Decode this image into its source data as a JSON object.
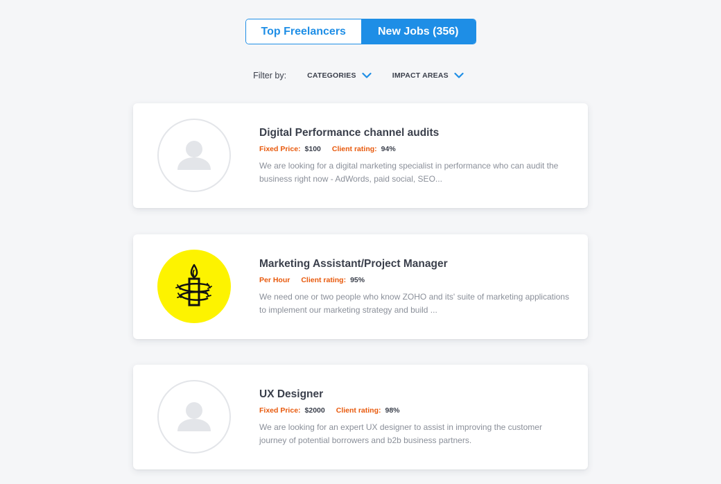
{
  "tabs": [
    {
      "label": "Top Freelancers",
      "active": false
    },
    {
      "label": "New Jobs (356)",
      "active": true
    }
  ],
  "filter": {
    "label": "Filter by:",
    "options": [
      {
        "label": "CATEGORIES",
        "icon": "chevron-down-icon"
      },
      {
        "label": "IMPACT AREAS",
        "icon": "chevron-down-icon"
      }
    ]
  },
  "jobs": [
    {
      "title": "Digital Performance channel audits",
      "pay_label": "Fixed Price:",
      "pay_value": "$100",
      "rating_label": "Client rating:",
      "rating_value": "94%",
      "description": "We are looking for a digital marketing specialist in performance who can  audit the business right now - AdWords, paid social, SEO...",
      "avatar": "user-placeholder-icon"
    },
    {
      "title": "Marketing Assistant/Project Manager",
      "pay_label": "Per Hour",
      "pay_value": "",
      "rating_label": "Client rating:",
      "rating_value": "95%",
      "description": "We need one or two people who know ZOHO and its' suite of marketing applications to implement our marketing strategy and build ...",
      "avatar": "candle-logo-icon"
    },
    {
      "title": "UX Designer",
      "pay_label": "Fixed Price:",
      "pay_value": "$2000",
      "rating_label": "Client rating:",
      "rating_value": "98%",
      "description": "We are looking for an expert UX designer to assist in improving the customer journey of potential borrowers and b2b business partners.",
      "avatar": "user-placeholder-icon"
    }
  ],
  "colors": {
    "accent": "#1e8ee6",
    "label_orange": "#e8590c",
    "logo_yellow": "#fdf300",
    "background": "#f5f6f8"
  }
}
